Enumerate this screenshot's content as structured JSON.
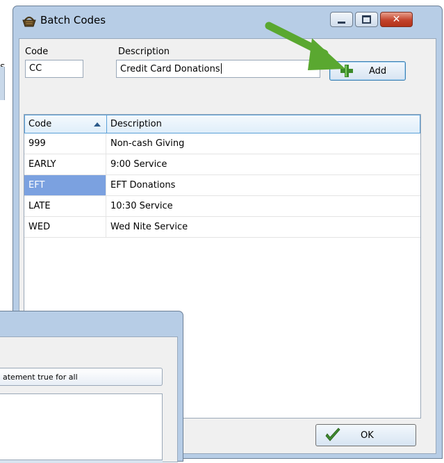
{
  "background": {
    "fragment_text": "s"
  },
  "window": {
    "title": "Batch Codes",
    "icon": "basket-icon",
    "controls": {
      "minimize": "minimize-icon",
      "maximize": "maximize-icon",
      "close": "close-icon"
    }
  },
  "form": {
    "code_label": "Code",
    "code_value": "CC",
    "description_label": "Description",
    "description_value": "Credit Card Donations",
    "add_button_label": "Add"
  },
  "grid": {
    "columns": [
      "Code",
      "Description"
    ],
    "sort_column": "Code",
    "sort_direction": "ascending",
    "rows": [
      {
        "code": "999",
        "description": "Non-cash Giving"
      },
      {
        "code": "EARLY",
        "description": "9:00 Service"
      },
      {
        "code": "EFT",
        "description": "EFT Donations"
      },
      {
        "code": "LATE",
        "description": "10:30 Service"
      },
      {
        "code": "WED",
        "description": "Wed Nite Service"
      }
    ],
    "selected_row": 2
  },
  "ok_button_label": "OK",
  "overlay_window": {
    "field_text": "atement true for all"
  },
  "colors": {
    "titlebar": "#b7cde6",
    "selection": "#7ba1e0",
    "header_border": "#5aa0d8",
    "arrow": "#5aa830"
  }
}
